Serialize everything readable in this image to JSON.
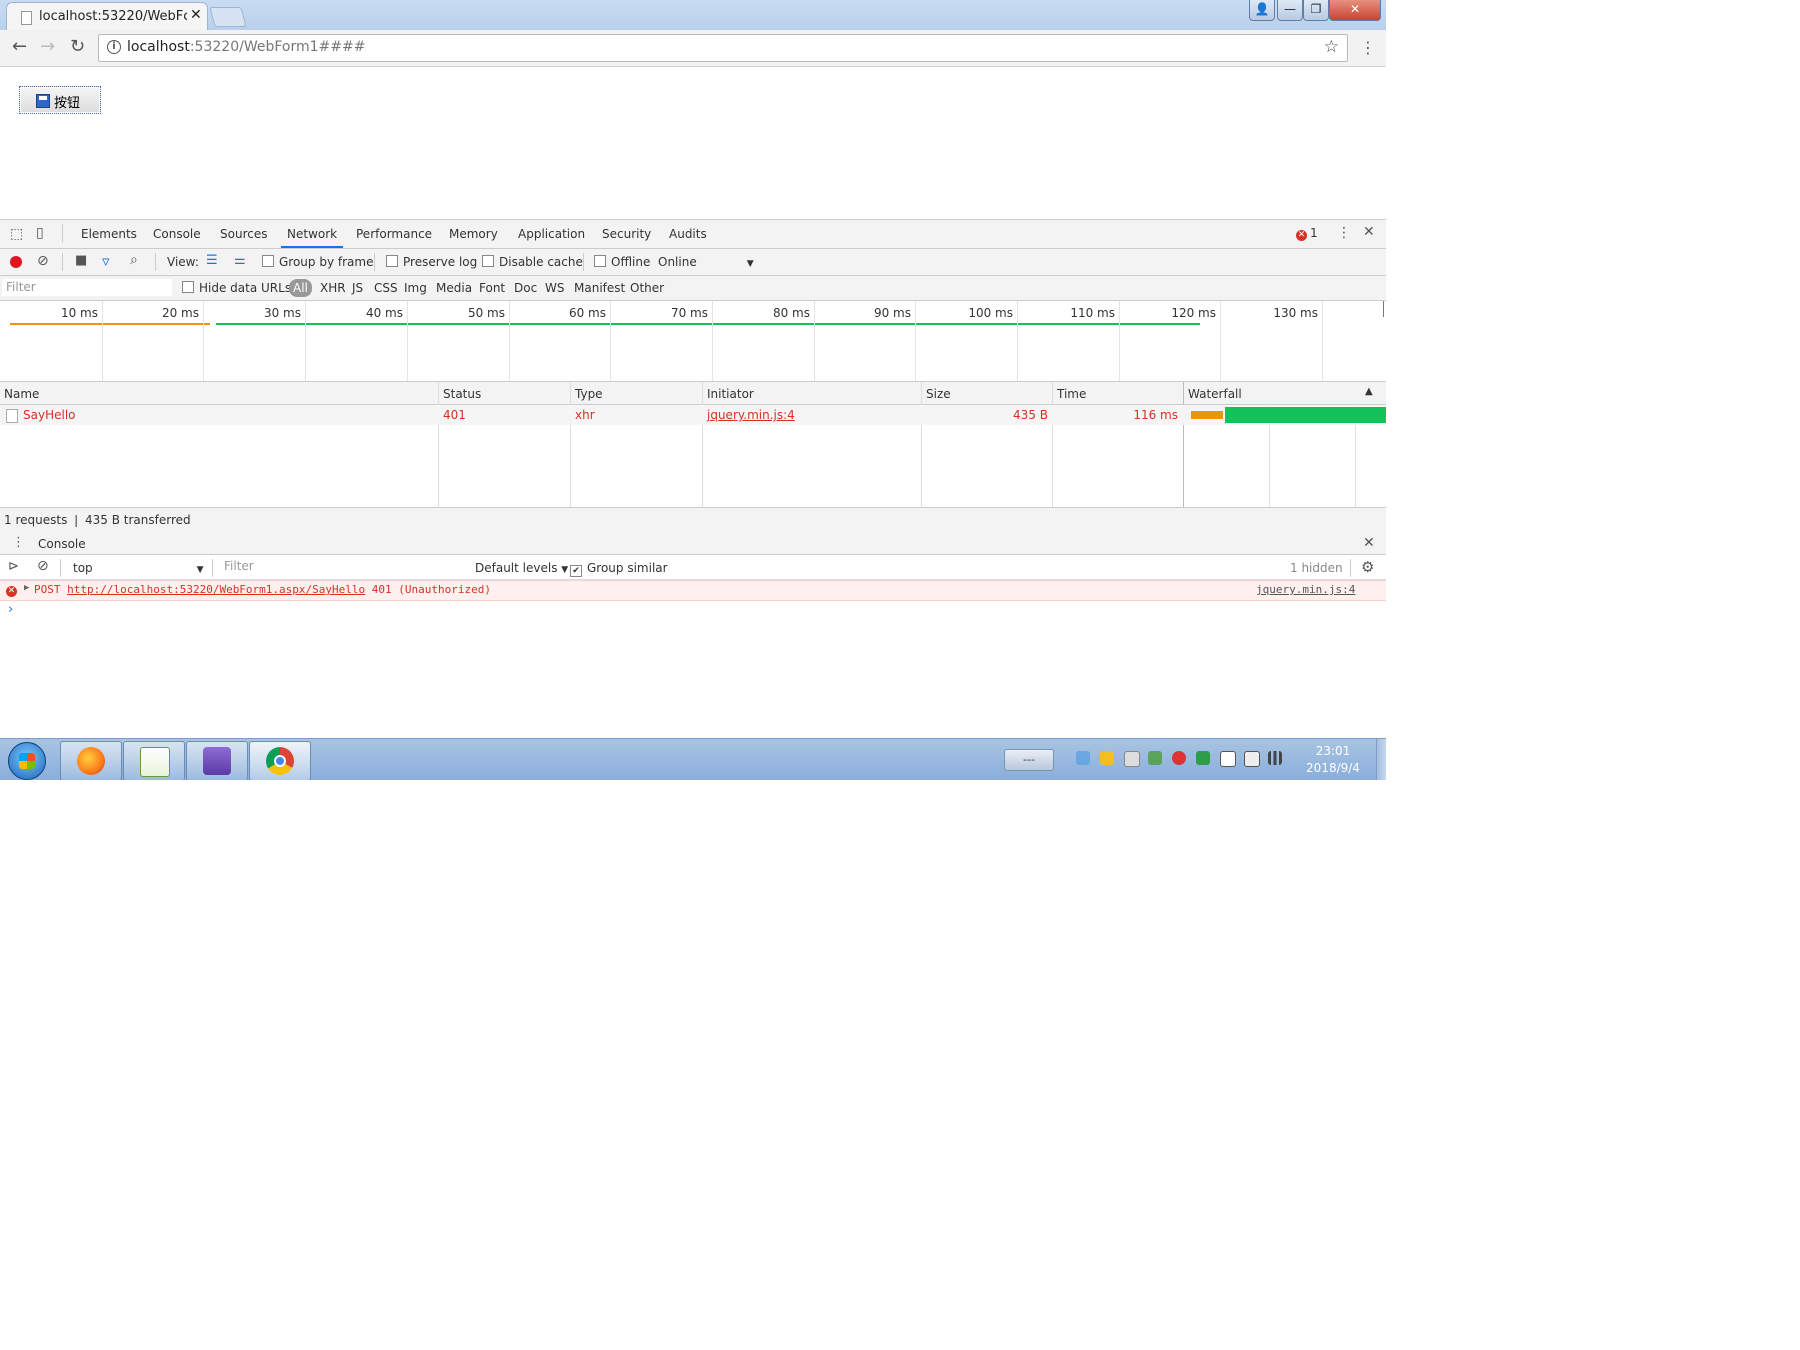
{
  "browser": {
    "tab_title": "localhost:53220/WebFc",
    "tab_close": "✕",
    "url_host": "localhost",
    "url_rest": ":53220/WebForm1####",
    "win_user": "👤",
    "win_min": "—",
    "win_max": "❐",
    "win_close": "✕"
  },
  "page": {
    "button_label": "按钮"
  },
  "devtools": {
    "tabs": [
      "Elements",
      "Console",
      "Sources",
      "Network",
      "Performance",
      "Memory",
      "Application",
      "Security",
      "Audits"
    ],
    "active_tab": "Network",
    "error_count": "1",
    "network": {
      "view_label": "View:",
      "group_by_frame": "Group by frame",
      "preserve_log": "Preserve log",
      "disable_cache": "Disable cache",
      "offline": "Offline",
      "throttle": "Online",
      "filter_placeholder": "Filter",
      "hide_data_urls": "Hide data URLs",
      "types": [
        "All",
        "XHR",
        "JS",
        "CSS",
        "Img",
        "Media",
        "Font",
        "Doc",
        "WS",
        "Manifest",
        "Other"
      ],
      "timeline_ticks": [
        "10 ms",
        "20 ms",
        "30 ms",
        "40 ms",
        "50 ms",
        "60 ms",
        "70 ms",
        "80 ms",
        "90 ms",
        "100 ms",
        "110 ms",
        "120 ms",
        "130 ms"
      ],
      "columns": [
        "Name",
        "Status",
        "Type",
        "Initiator",
        "Size",
        "Time",
        "Waterfall"
      ],
      "rows": [
        {
          "name": "SayHello",
          "status": "401",
          "type": "xhr",
          "initiator": "jquery.min.js:4",
          "size": "435 B",
          "time": "116 ms"
        }
      ],
      "summary": "1 requests  ❘  435 B transferred"
    },
    "console": {
      "drawer_tab": "Console",
      "context": "top",
      "filter_placeholder": "Filter",
      "levels": "Default levels",
      "group_similar": "Group similar",
      "hidden": "1 hidden",
      "error_method": "POST",
      "error_url": "http://localhost:53220/WebForm1.aspx/SayHello",
      "error_status": "401 (Unauthorized)",
      "error_source": "jquery.min.js:4",
      "prompt": "›"
    }
  },
  "taskbar": {
    "time": "23:01",
    "date": "2018/9/4",
    "show_desktop_label": "---"
  },
  "colors": {
    "accent": "#1a73e8",
    "error": "#d93025",
    "waterfall_wait": "#f0910f",
    "waterfall_download": "#12c25a"
  }
}
